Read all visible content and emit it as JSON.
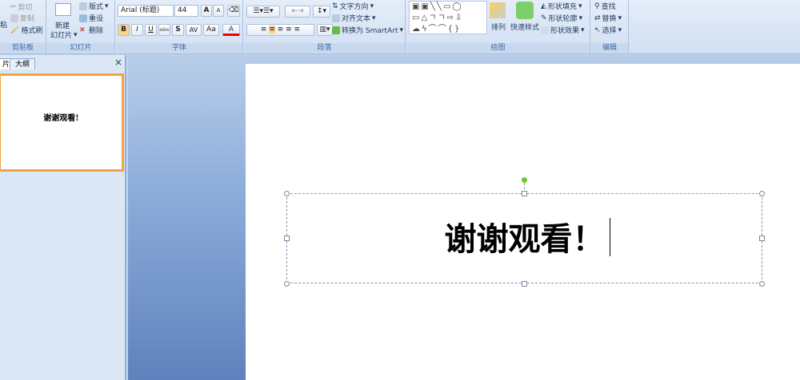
{
  "ribbon": {
    "clipboard": {
      "label": "剪贴板",
      "paste": "粘",
      "cut": "剪切",
      "copy": "复制",
      "format_painter": "格式刷"
    },
    "slides": {
      "label": "幻灯片",
      "new_slide_1": "新建",
      "new_slide_2": "幻灯片",
      "layout": "版式",
      "reset": "重设",
      "delete": "删除"
    },
    "font": {
      "label": "字体",
      "font_name": "Arial (标题)",
      "font_size": "44",
      "bold": "B",
      "italic": "I",
      "underline": "U",
      "strike": "abc",
      "shadow": "S",
      "spacing": "AV",
      "case": "Aa",
      "color": "A",
      "grow": "A",
      "shrink": "A"
    },
    "paragraph": {
      "label": "段落",
      "text_direction": "文字方向",
      "align_text": "对齐文本",
      "smartart": "转换为 SmartArt"
    },
    "drawing": {
      "label": "绘图",
      "arrange": "排列",
      "quick_styles": "快速样式",
      "shape_fill": "形状填充",
      "shape_outline": "形状轮廓",
      "shape_effects": "形状效果"
    },
    "editing": {
      "label": "编辑",
      "find": "查找",
      "replace": "替换",
      "select": "选择"
    }
  },
  "pane": {
    "tab_slides": "片",
    "tab_outline": "大纲",
    "close": "×",
    "thumb_text": "谢谢观看!"
  },
  "slide": {
    "title": "谢谢观看！"
  }
}
